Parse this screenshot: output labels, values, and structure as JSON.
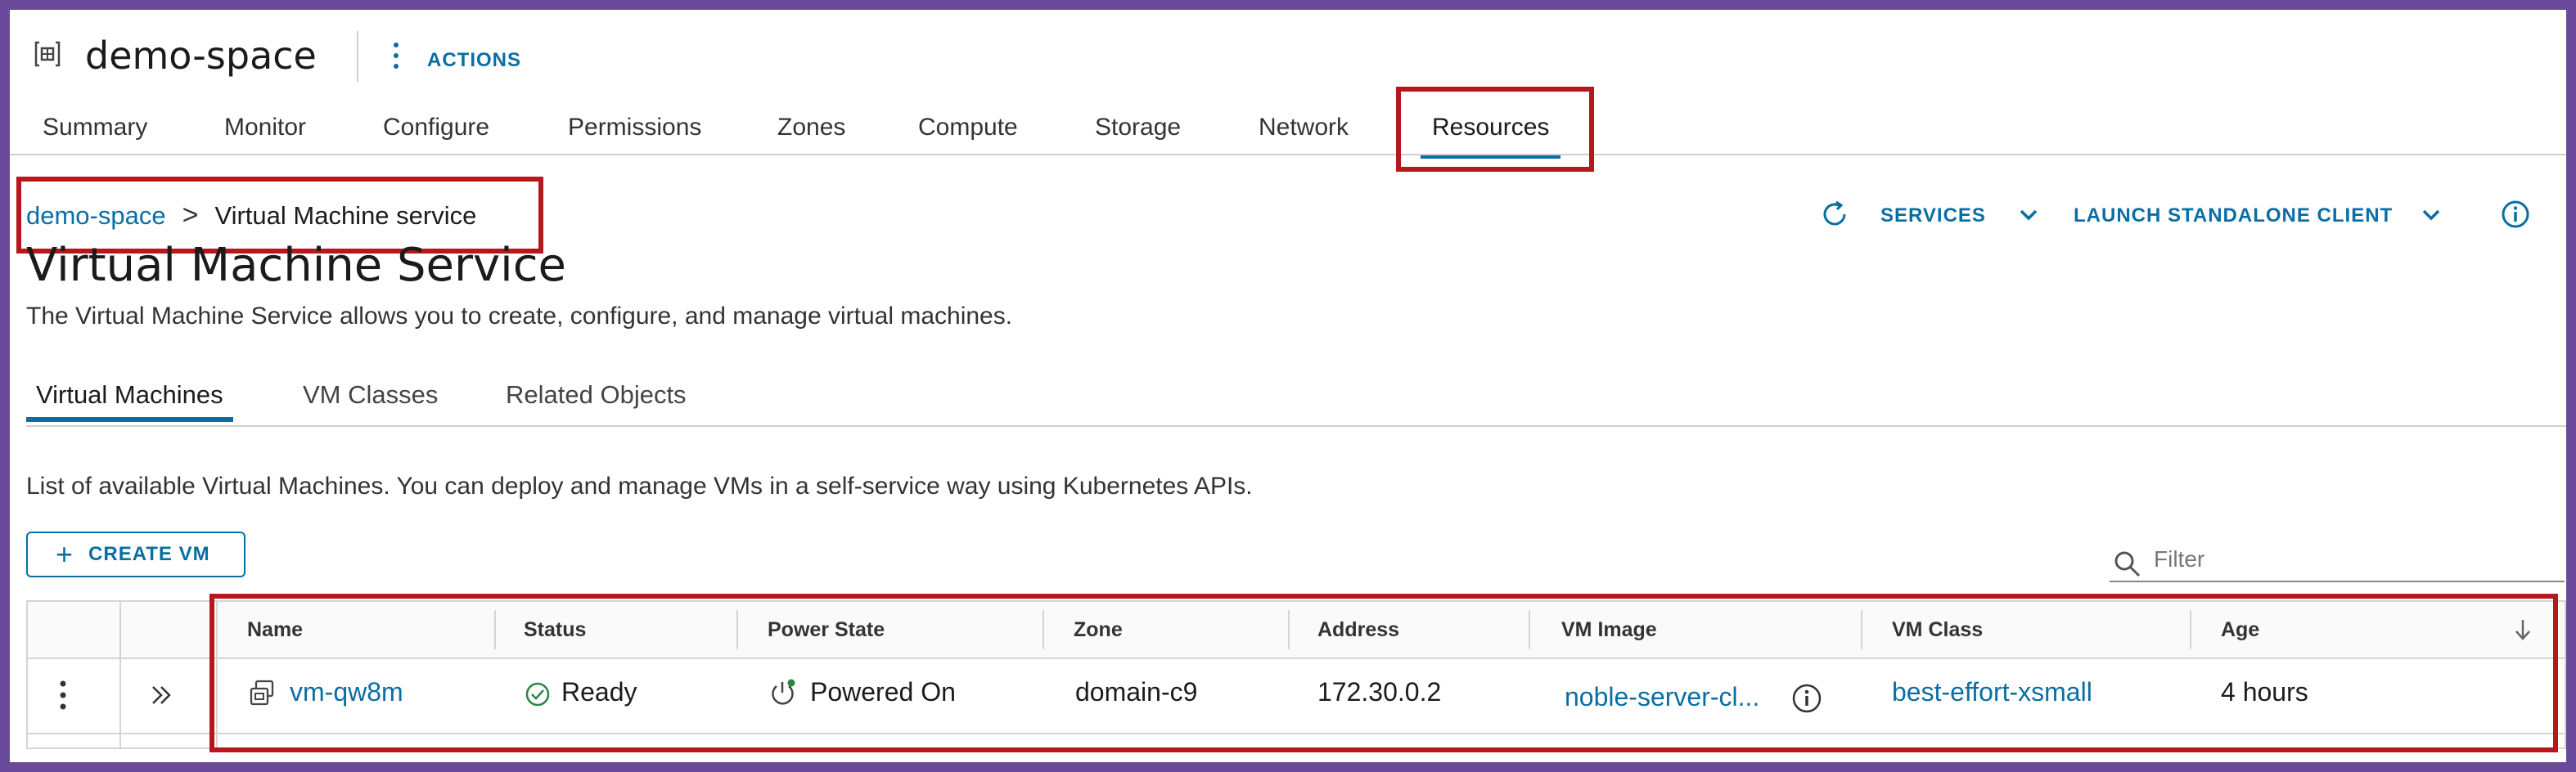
{
  "header": {
    "title": "demo-space",
    "actions_label": "ACTIONS",
    "icon": "namespace-icon"
  },
  "main_tabs": [
    {
      "label": "Summary",
      "active": false
    },
    {
      "label": "Monitor",
      "active": false
    },
    {
      "label": "Configure",
      "active": false
    },
    {
      "label": "Permissions",
      "active": false
    },
    {
      "label": "Zones",
      "active": false
    },
    {
      "label": "Compute",
      "active": false
    },
    {
      "label": "Storage",
      "active": false
    },
    {
      "label": "Network",
      "active": false
    },
    {
      "label": "Resources",
      "active": true
    }
  ],
  "breadcrumb": {
    "parent": "demo-space",
    "separator": ">",
    "current": "Virtual Machine service"
  },
  "toolbar_right": {
    "refresh_icon": "refresh-icon",
    "services_label": "SERVICES",
    "launch_label": "LAUNCH STANDALONE CLIENT",
    "info_icon": "info-icon"
  },
  "page": {
    "title": "Virtual Machine Service",
    "description": "The Virtual Machine Service allows you to create, configure, and manage virtual machines."
  },
  "sub_tabs": [
    {
      "label": "Virtual Machines",
      "active": true
    },
    {
      "label": "VM Classes",
      "active": false
    },
    {
      "label": "Related Objects",
      "active": false
    }
  ],
  "list": {
    "description": "List of available Virtual Machines. You can deploy and manage VMs in a self-service way using Kubernetes APIs.",
    "create_label": "CREATE VM",
    "filter_placeholder": "Filter"
  },
  "table": {
    "columns": [
      "Name",
      "Status",
      "Power State",
      "Zone",
      "Address",
      "VM Image",
      "VM Class",
      "Age"
    ],
    "rows": [
      {
        "name": "vm-qw8m",
        "status": "Ready",
        "power_state": "Powered On",
        "zone": "domain-c9",
        "address": "172.30.0.2",
        "vm_image": "noble-server-cl...",
        "vm_class": "best-effort-xsmall",
        "age": "4 hours"
      }
    ]
  },
  "colors": {
    "accent": "#0a6ea3",
    "highlight_box": "#b5171d",
    "frame": "#6a4a9a",
    "ready_green": "#2e8540"
  }
}
